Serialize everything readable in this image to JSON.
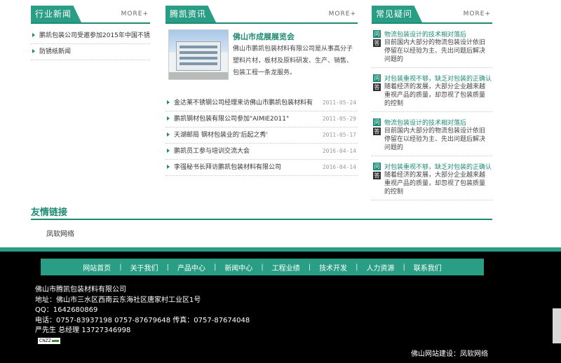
{
  "news": {
    "title": "行业新闻",
    "more": "MORE+",
    "items": [
      "鹏凯包装公司受邀参加2015年中国不锈钢行",
      "防锈纸新闻"
    ]
  },
  "info": {
    "title": "腾凯资讯",
    "more": "MORE+",
    "featured": {
      "title": "佛山市成展展览会",
      "desc": "佛山市鹏凯包装材料有限公司是从事高分子塑料片材，板材及原料研发、生产、销售、包装工程一条龙服务。"
    },
    "items": [
      {
        "text": "金达莱不锈钢公司经理来访佛山市鹏凯包装材料有",
        "date": "2011-05-24"
      },
      {
        "text": "鹏凯钢材包装有限公司参加\"AIMIE2011\"",
        "date": "2011-05-29"
      },
      {
        "text": "天湖邮局 钢材包装业的'后起之秀'",
        "date": "2011-05-17"
      },
      {
        "text": "鹏凯员工参与培训交流大会",
        "date": "2016-04-14"
      },
      {
        "text": "李强秘书长拜访鹏凯包装材料有限公司",
        "date": "2016-04-14"
      }
    ]
  },
  "faq": {
    "title": "常见疑问",
    "more": "MORE+",
    "q_mark": "问",
    "a_mark": "答",
    "items": [
      {
        "q": "物流包装设计的技术相对落后",
        "a": "目前国内大部分的物流包装设计依旧停留在以经验为主、先出问题后解决问题的"
      },
      {
        "q": "对包装重视不够，缺乏对包装的正确认",
        "a": "随着经济的发展，大部分企业越来越重视产品的质量，却忽视了包装质量的控制"
      },
      {
        "q": "物流包装设计的技术相对落后",
        "a": "目前国内大部分的物流包装设计依旧停留在以经验为主、先出问题后解决问题的"
      },
      {
        "q": "对包装重视不够，缺乏对包装的正确认",
        "a": "随着经济的发展，大部分企业越来越重视产品的质量，却忽视了包装质量的控制"
      }
    ]
  },
  "links": {
    "title": "友情链接",
    "items": [
      "凤软网络"
    ]
  },
  "footer": {
    "nav": [
      "网站首页",
      "关于我们",
      "产品中心",
      "新闻中心",
      "工程业绩",
      "技术开发",
      "人力资源",
      "联系我们"
    ],
    "separator": "|",
    "company": "佛山市腾凯包装材料有限公司",
    "address": "地址：佛山市三水区西南云东海社区唐家村工业区1号",
    "qq": "QQ：1642680869",
    "phone": "电话：0757-83937198  0757-87679648    传真：0757-87674048",
    "contact": "严先生 总经理   13727346998",
    "cnzz": "CNZZ",
    "credit": "佛山网站建设：凤软网络"
  },
  "colors": {
    "accent": "#2a9e84",
    "accent_dark": "#1d8a73",
    "footer_bg": "#000000"
  }
}
